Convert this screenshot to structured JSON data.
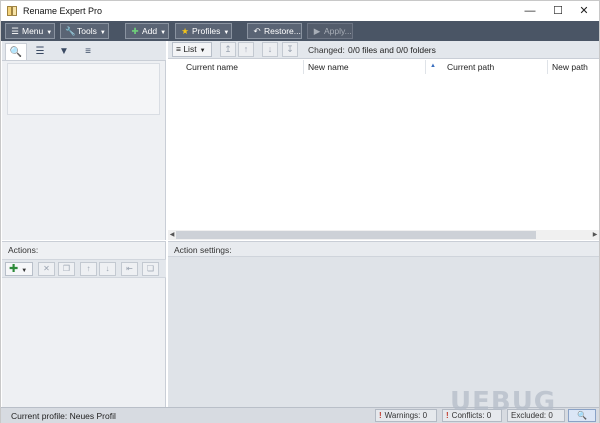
{
  "window": {
    "title": "Rename Expert Pro"
  },
  "toolbar": {
    "menu": "Menu",
    "tools": "Tools",
    "add": "Add",
    "profiles": "Profiles",
    "restore": "Restore...",
    "apply": "Apply..."
  },
  "main": {
    "view_mode": "List",
    "changed_label": "Changed:",
    "changed_value": "0/0 files and 0/0 folders",
    "columns": [
      "Current name",
      "New name",
      "Current path",
      "New path"
    ]
  },
  "actions": {
    "label": "Actions:"
  },
  "settings": {
    "label": "Action settings:"
  },
  "status": {
    "profile": "Current profile: Neues Profil",
    "warnings": "Warnings: 0",
    "conflicts": "Conflicts: 0",
    "excluded": "Excluded: 0"
  },
  "watermark": "UEBUG",
  "colors": {
    "toolbar_bg": "#4a5565",
    "accent": "#3a6fbf",
    "add_green": "#2e8b3a"
  },
  "icons": [
    "app-icon",
    "minimize-icon",
    "maximize-icon",
    "close-icon",
    "menu-icon",
    "tools-icon",
    "plus-icon",
    "star-icon",
    "restore-icon",
    "apply-icon",
    "search-icon",
    "tree-icon",
    "filter-icon",
    "list-icon",
    "arrow-up-icon",
    "arrow-down-icon",
    "delete-icon"
  ]
}
